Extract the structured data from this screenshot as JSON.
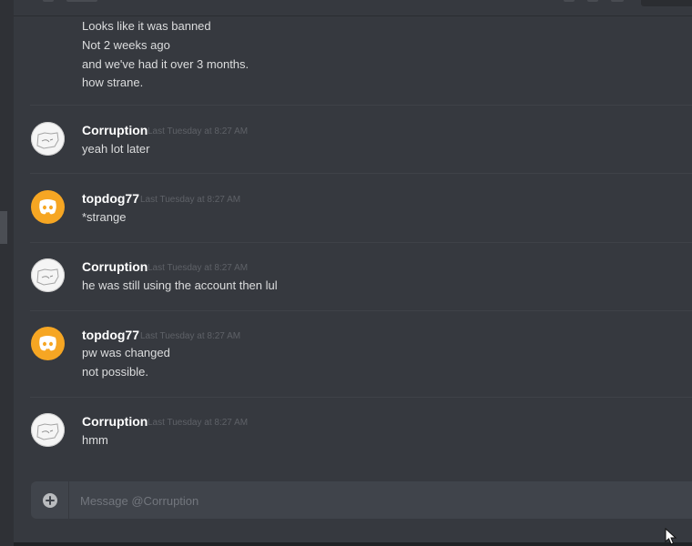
{
  "conversation": {
    "composer_placeholder": "Message @Corruption",
    "header_fragment": {
      "top_message": [
        "Looks like it was banned",
        "Not 2 weeks ago",
        "and we've had it over 3 months.",
        "how strane."
      ]
    },
    "messages": [
      {
        "author": "Corruption",
        "timestamp": "Last Tuesday at 8:27 AM",
        "lines": [
          "yeah lot later"
        ],
        "avatar": "sketch-avatar"
      },
      {
        "author": "topdog77",
        "timestamp": "Last Tuesday at 8:27 AM",
        "lines": [
          "*strange"
        ],
        "avatar": "discord-logo-avatar"
      },
      {
        "author": "Corruption",
        "timestamp": "Last Tuesday at 8:27 AM",
        "lines": [
          "he was still using the account then lul"
        ],
        "avatar": "sketch-avatar"
      },
      {
        "author": "topdog77",
        "timestamp": "Last Tuesday at 8:27 AM",
        "lines": [
          "pw was changed",
          "not possible."
        ],
        "avatar": "discord-logo-avatar"
      },
      {
        "author": "Corruption",
        "timestamp": "Last Tuesday at 8:27 AM",
        "lines": [
          "hmm"
        ],
        "avatar": "sketch-avatar"
      }
    ]
  },
  "icons": {
    "add": "plus-circle-icon",
    "cursor": "mouse-pointer-icon",
    "discord": "discord-logo-icon"
  },
  "colors": {
    "background": "#36393f",
    "sidebar": "#2f3136",
    "composer": "#40444b",
    "orange_avatar": "#f6a623",
    "username": "#ffffff",
    "text": "#dcddde",
    "timestamp": "#5e6167",
    "placeholder": "#72767d"
  }
}
